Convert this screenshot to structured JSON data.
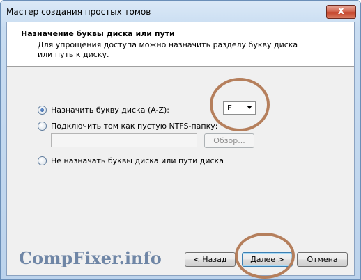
{
  "window": {
    "title": "Мастер создания простых томов",
    "close_label": "X"
  },
  "header": {
    "title": "Назначение буквы диска или пути",
    "subtitle": "Для упрощения доступа можно назначить разделу букву диска или путь к диску."
  },
  "options": {
    "assign_letter": {
      "label": "Назначить букву диска (A-Z):",
      "checked": true
    },
    "mount_folder": {
      "label": "Подключить том как пустую NTFS-папку:",
      "checked": false
    },
    "no_letter": {
      "label": "Не назначать буквы диска или пути диска",
      "checked": false
    }
  },
  "drive_letter": {
    "selected": "E"
  },
  "folder_path": {
    "value": ""
  },
  "buttons": {
    "browse": "Обзор...",
    "back": "< Назад",
    "next": "Далее >",
    "cancel": "Отмена"
  },
  "watermark": "CompFixer.info",
  "colors": {
    "annotation_circle": "#b57f5c",
    "watermark": "#6f86a6",
    "close_button": "#c5452b"
  }
}
